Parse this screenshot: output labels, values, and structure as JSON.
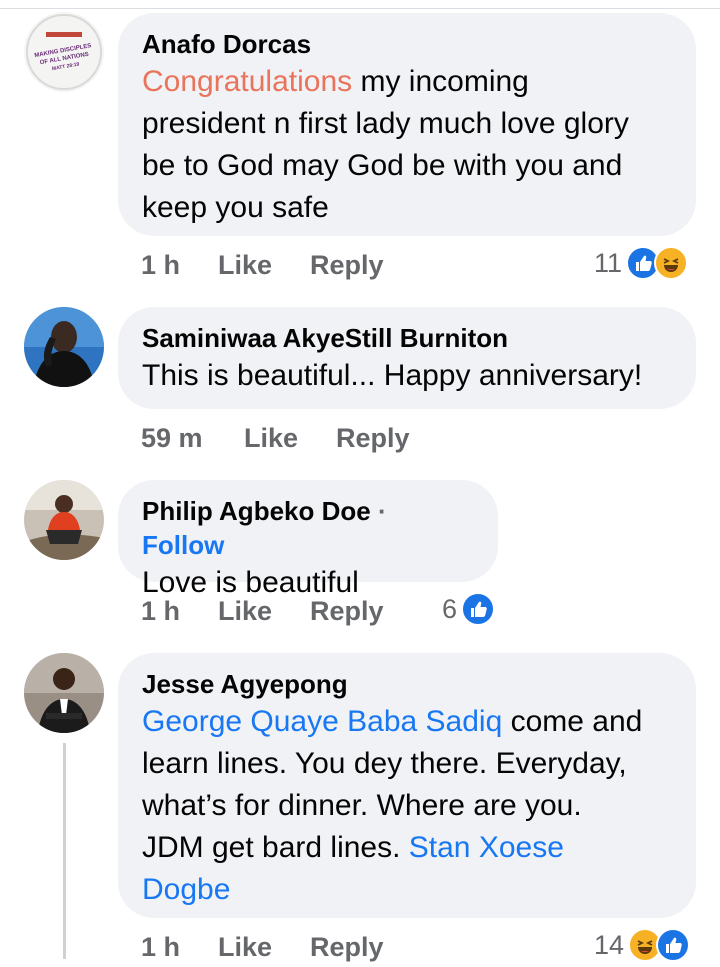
{
  "comments": [
    {
      "author": "Anafo Dorcas",
      "text_highlight": "Congratulations",
      "text_rest_1": " my incoming",
      "text_lines": [
        "president n first lady much love glory",
        "be to God may God be with you and",
        "keep you safe"
      ],
      "time": "1 h",
      "like_label": "Like",
      "reply_label": "Reply",
      "reaction_count": "11",
      "reactions": [
        "like",
        "haha"
      ],
      "avatar_stamp": [
        "MAKING DISCIPLES",
        "OF ALL NATIONS",
        "MATT 28:19"
      ]
    },
    {
      "author": "Saminiwaa AkyeStill Burniton",
      "text": "This is beautiful... Happy anniversary!",
      "time": "59 m",
      "like_label": "Like",
      "reply_label": "Reply"
    },
    {
      "author": "Philip Agbeko Doe",
      "follow_label": "Follow",
      "text": "Love is beautiful",
      "time": "1 h",
      "like_label": "Like",
      "reply_label": "Reply",
      "reaction_count": "6",
      "reactions": [
        "like"
      ]
    },
    {
      "author": "Jesse Agyepong",
      "mention_1": "George Quaye Baba Sadiq",
      "text_after_mention_1": " come and",
      "text_lines": [
        "learn lines. You dey there.  Everyday,",
        "what’s for dinner. Where are you."
      ],
      "text_before_mention_2": "JDM get bard lines. ",
      "mention_2a": "Stan Xoese",
      "mention_2b": "Dogbe",
      "time": "1 h",
      "like_label": "Like",
      "reply_label": "Reply",
      "reaction_count": "14",
      "reactions": [
        "haha",
        "like"
      ]
    }
  ],
  "colors": {
    "bubble": "#f0f2f5",
    "link": "#1877f2",
    "highlight": "#e9735b",
    "meta": "#65676b",
    "like": "#1b74e4",
    "haha": "#f7b125"
  }
}
